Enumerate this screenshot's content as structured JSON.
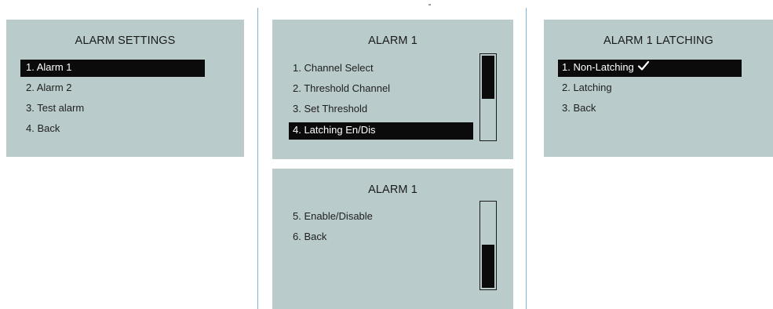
{
  "alarm_settings": {
    "title": "ALARM SETTINGS",
    "items": [
      {
        "label": "1.  Alarm 1"
      },
      {
        "label": "2. Alarm 2"
      },
      {
        "label": "3. Test alarm"
      },
      {
        "label": "4. Back"
      }
    ],
    "selected_index": 0
  },
  "alarm1_page1": {
    "title": "ALARM 1",
    "items": [
      {
        "label": "1.  Channel Select"
      },
      {
        "label": "2. Threshold Channel"
      },
      {
        "label": "3. Set Threshold"
      },
      {
        "label": "4. Latching En/Dis"
      }
    ],
    "selected_index": 3,
    "scroll_position": "top"
  },
  "alarm1_page2": {
    "title": "ALARM 1",
    "items": [
      {
        "label": "5.  Enable/Disable"
      },
      {
        "label": "6. Back"
      }
    ],
    "scroll_position": "bottom"
  },
  "alarm1_latching": {
    "title": "ALARM 1 LATCHING",
    "items": [
      {
        "label": "1.  Non-Latching"
      },
      {
        "label": "2. Latching"
      },
      {
        "label": "3. Back"
      }
    ],
    "selected_index": 0,
    "checked_index": 0,
    "check_icon": "checkmark-icon"
  },
  "colors": {
    "screen_background": "#b9cccb",
    "selection_background": "#0b0b0b",
    "selection_text": "#ffffff",
    "divider": "#7fb3d9"
  }
}
